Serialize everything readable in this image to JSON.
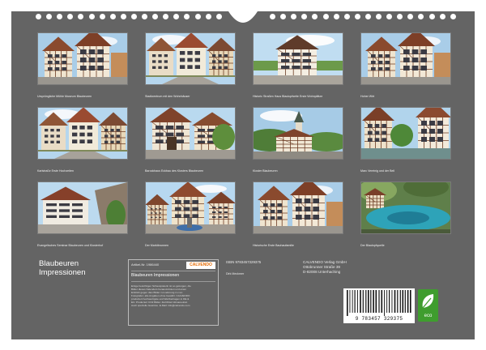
{
  "cover": {
    "title_line1": "Blaubeuren",
    "title_line2": "Impressionen"
  },
  "photos": [
    {
      "caption": "Ursprüngliche Mühle Museum Blaubeuren",
      "scene": "half-timbered"
    },
    {
      "caption": "Stadtzentrum mit den Wohnhäuser",
      "scene": "street"
    },
    {
      "caption": "Historic Straßen Haus Blautopfseite Erste Wohnplätze",
      "scene": "house"
    },
    {
      "caption": "Hoher Wirt",
      "scene": "half-timbered"
    },
    {
      "caption": "Karlstraße Erste Hochzeiten",
      "scene": "street"
    },
    {
      "caption": "Barockhaus Eckbau des Klosters Blaubeuren",
      "scene": "gate"
    },
    {
      "caption": "Kloster Blaubeuren",
      "scene": "church"
    },
    {
      "caption": "Marc Vereinig und der Bell",
      "scene": "canal"
    },
    {
      "caption": "Evangelisches Seminar Blaubeuren und Klosterhof",
      "scene": "seminar"
    },
    {
      "caption": "Der Marktbrunnen",
      "scene": "townhall"
    },
    {
      "caption": "Historische Erste Bauhaufamilie",
      "scene": "half-timbered"
    },
    {
      "caption": "Der Blautopfquelle",
      "scene": "spring"
    }
  ],
  "info": {
    "article_label": "Artikel-Nr. 1986440",
    "logo_text": "CALVENDO",
    "calendar_title": "Blaubeuren Impressionen",
    "fine_print": "Einige besichtigen Schauspielerin ist so gelungen, die Bilder dieses Kalenders herauszuholen und einen Einblick gegen dies Bilder zu Lieferung zu von Fotografen; alle Angaben ohne Gewähr. CALVENDO produziert hochwertigste und Wertbeitragen in DE & EU. Produziert CO2 Bilder. Zertifiziert klimaneutral. Auch spezielle Gewinne. E-Mail: info@calvendo.com",
    "isbn": "ISBN 9783457329375",
    "photographer": "Dirk Meckmer",
    "publisher_name": "CALVENDO Verlag GmbH",
    "publisher_street": "Ottobrunner Straße 39",
    "publisher_city": "D-82008 Unterhaching",
    "barcode_number": "9 783457 329375",
    "eco_label": "eco"
  },
  "colors": {
    "sheet_background": "#646464",
    "eco_green": "#3f9d2e",
    "logo_orange": "#e66a00"
  }
}
